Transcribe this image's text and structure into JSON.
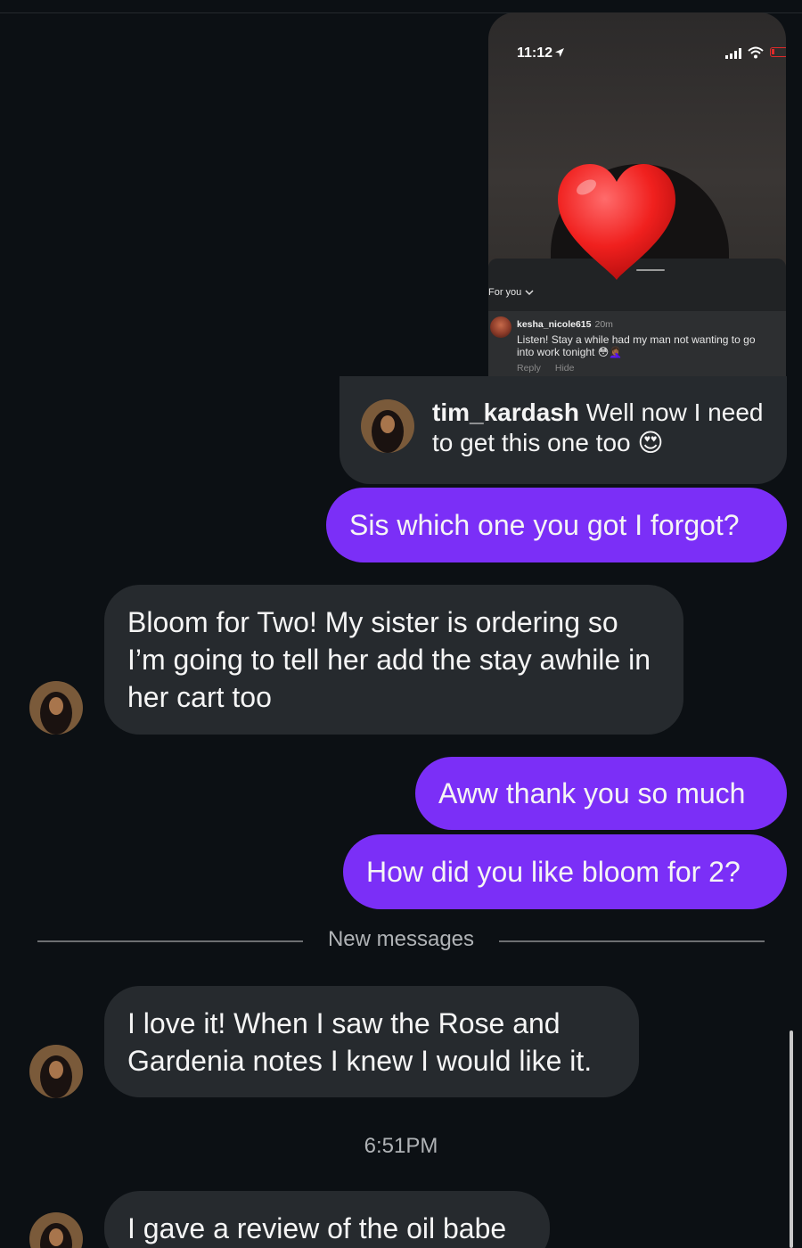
{
  "story_preview": {
    "status_time": "11:12",
    "for_you_label": "For you",
    "comment": {
      "username": "kesha_nicole615",
      "time_ago": "20m",
      "text": "Listen! Stay a while had my man not wanting to go into work tonight 😳🤦🏾‍♀️",
      "reply_label": "Reply",
      "hide_label": "Hide"
    },
    "reaction": "heart"
  },
  "reply_card": {
    "username": "tim_kardash",
    "text": "Well now I need to get this one too 😍"
  },
  "messages": [
    {
      "direction": "outgoing",
      "text": "Sis which one you got I forgot?"
    },
    {
      "direction": "incoming",
      "text": "Bloom for Two! My sister is ordering so I’m going to tell her add the stay awhile in her cart too"
    },
    {
      "direction": "outgoing",
      "text": "Aww thank you so much"
    },
    {
      "direction": "outgoing",
      "text": "How did you like bloom for 2?"
    },
    {
      "direction": "incoming",
      "text": "I love it! When I saw the Rose and Gardenia notes I knew I would like it."
    },
    {
      "direction": "incoming",
      "text": "I gave a review of the oil babe"
    }
  ],
  "new_messages_label": "New messages",
  "timestamp": "6:51PM",
  "colors": {
    "background": "#0c1014",
    "outgoing_bubble": "#7b2ff7",
    "incoming_bubble": "#262a2e"
  }
}
